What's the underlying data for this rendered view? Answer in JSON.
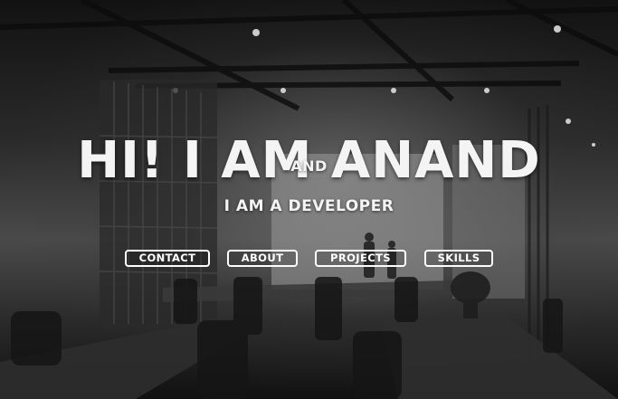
{
  "hero": {
    "title": "HI! I AM ANAND",
    "connector": "AND",
    "role": "I AM A DEVELOPER"
  },
  "nav": {
    "items": [
      {
        "label": "CONTACT"
      },
      {
        "label": "ABOUT"
      },
      {
        "label": "PROJECTS"
      },
      {
        "label": "SKILLS"
      }
    ]
  },
  "colors": {
    "text": "#f4f4f4",
    "button_border": "#ffffff"
  }
}
